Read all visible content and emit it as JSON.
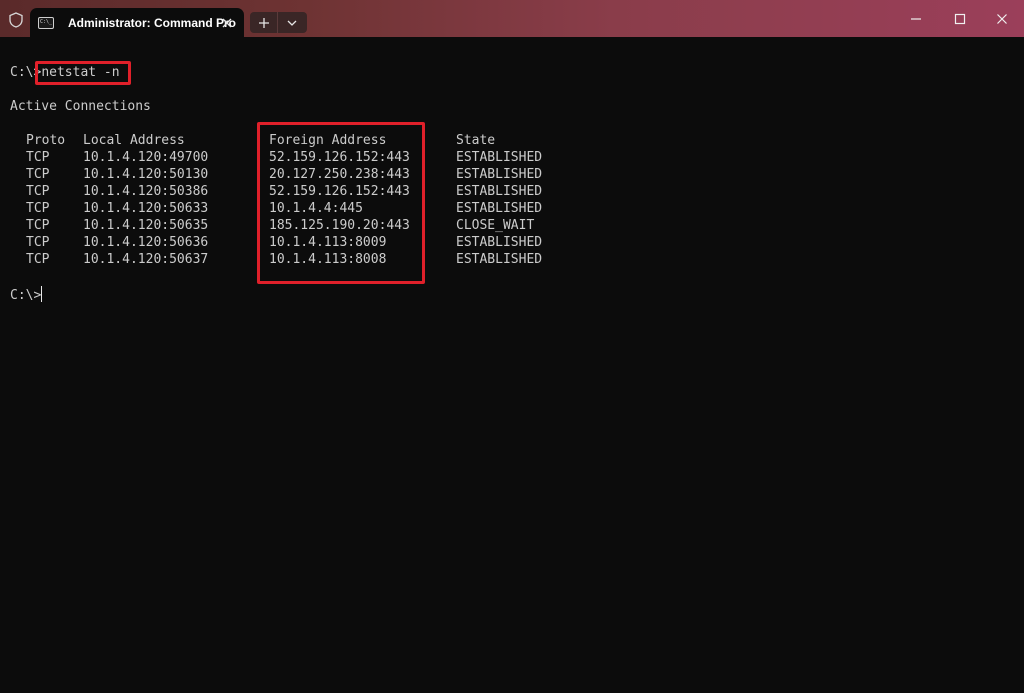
{
  "window": {
    "tab_title": "Administrator: Command Pro",
    "tab_icon_text": "C:\\_"
  },
  "terminal": {
    "prompt": "C:\\>",
    "command": "netstat -n",
    "heading": "Active Connections",
    "headers": {
      "proto": "Proto",
      "local": "Local Address",
      "foreign": "Foreign Address",
      "state": "State"
    },
    "rows": [
      {
        "proto": "TCP",
        "local": "10.1.4.120:49700",
        "foreign": "52.159.126.152:443",
        "state": "ESTABLISHED"
      },
      {
        "proto": "TCP",
        "local": "10.1.4.120:50130",
        "foreign": "20.127.250.238:443",
        "state": "ESTABLISHED"
      },
      {
        "proto": "TCP",
        "local": "10.1.4.120:50386",
        "foreign": "52.159.126.152:443",
        "state": "ESTABLISHED"
      },
      {
        "proto": "TCP",
        "local": "10.1.4.120:50633",
        "foreign": "10.1.4.4:445",
        "state": "ESTABLISHED"
      },
      {
        "proto": "TCP",
        "local": "10.1.4.120:50635",
        "foreign": "185.125.190.20:443",
        "state": "CLOSE_WAIT"
      },
      {
        "proto": "TCP",
        "local": "10.1.4.120:50636",
        "foreign": "10.1.4.113:8009",
        "state": "ESTABLISHED"
      },
      {
        "proto": "TCP",
        "local": "10.1.4.120:50637",
        "foreign": "10.1.4.113:8008",
        "state": "ESTABLISHED"
      }
    ],
    "final_prompt": "C:\\>"
  },
  "colors": {
    "highlight": "#e0202a",
    "terminal_bg": "#0c0c0c",
    "terminal_fg": "#cccccc"
  },
  "icons": {
    "shield": "shield-icon",
    "tab": "terminal-icon",
    "close": "close-icon",
    "plus": "plus-icon",
    "dropdown": "chevron-down-icon",
    "minimize": "minimize-icon",
    "maximize": "maximize-icon",
    "window_close": "window-close-icon"
  }
}
